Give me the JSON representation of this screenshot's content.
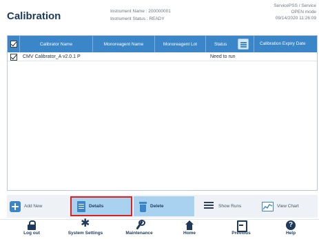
{
  "header": {
    "title": "Calibration",
    "instrument_name": "Instrument Name : 200000001",
    "instrument_status": "Instrument Status : READY",
    "user": "ServicePSS / Service",
    "mode": "OPEN mode",
    "datetime": "09/14/2020 11:26:09"
  },
  "table": {
    "columns": [
      "Calibrator Name",
      "Monoreagent Name",
      "Monoreagent Lot",
      "Status",
      "Calibration Expiry Date"
    ],
    "rows": [
      {
        "calibrator_name": "CMV Calibrator_A v2.0.1 P",
        "monoreagent_name": "",
        "monoreagent_lot": "",
        "status": "Need to run",
        "expiry": ""
      }
    ]
  },
  "actions": {
    "add_new": "Add New",
    "details": "Details",
    "delete": "Delete",
    "show_runs": "Show Runs",
    "view_chart": "View Chart"
  },
  "nav": {
    "logout": "Log out",
    "system_settings": "System Settings",
    "maintenance": "Maintenance",
    "home": "Home",
    "previous": "Previous",
    "help": "Help"
  },
  "colors": {
    "header_blue": "#3a86c8",
    "selected_button": "#a9d2f0",
    "highlight_border": "#e0211b"
  }
}
